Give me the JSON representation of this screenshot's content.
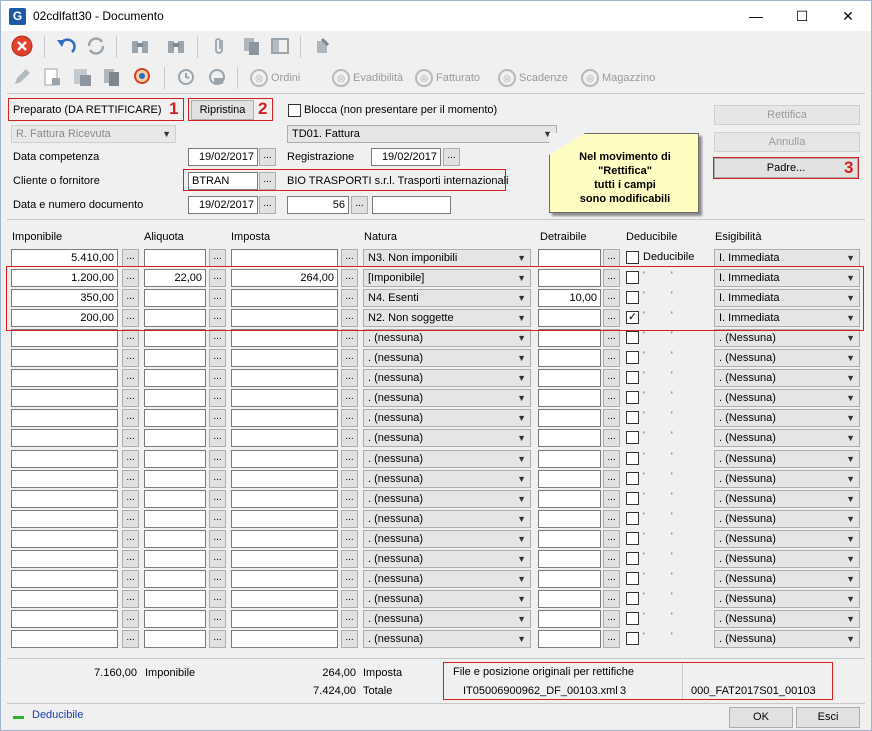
{
  "window": {
    "title": "02cdlfatt30 - Documento",
    "min": "—",
    "max": "☐",
    "close": "✕"
  },
  "toolbar2": {
    "ordini": "Ordini",
    "evadibilita": "Evadibilità",
    "fatturato": "Fatturato",
    "scadenze": "Scadenze",
    "magazzino": "Magazzino"
  },
  "header": {
    "stato": "Preparato (DA RETTIFICARE)",
    "ripristina": "Ripristina",
    "blocca": "Blocca (non presentare per il momento)",
    "tipo_doc": "R. Fattura Ricevuta",
    "td": "TD01. Fattura",
    "data_competenza_label": "Data competenza",
    "data_competenza": "19/02/2017",
    "registrazione_label": "Registrazione",
    "registrazione": "19/02/2017",
    "cliente_label": "Cliente o fornitore",
    "cliente_code": "BTRAN",
    "cliente_name": "BIO TRASPORTI s.r.l. Trasporti internazionali",
    "data_num_label": "Data e numero documento",
    "data_doc": "19/02/2017",
    "num_doc": "56",
    "num_doc_suffix": ""
  },
  "side_buttons": {
    "rettifica": "Rettifica",
    "annulla": "Annulla",
    "padre": "Padre..."
  },
  "note": {
    "line1": "Nel movimento di",
    "line2": "\"Rettifica\"",
    "line3": "tutti i campi",
    "line4": "sono modificabili"
  },
  "markers": {
    "m1": "1",
    "m2": "2",
    "m3": "3"
  },
  "dots": "...",
  "columns": {
    "imponibile": "Imponibile",
    "aliquota": "Aliquota",
    "imposta": "Imposta",
    "natura": "Natura",
    "detraibile": "Detraibile",
    "deducibile": "Deducibile",
    "esigibilita": "Esigibilità"
  },
  "rows": [
    {
      "imponibile": "5.410,00",
      "aliquota": "",
      "imposta": "",
      "natura": "N3. Non imponibili",
      "detraibile": "",
      "deducibile_checked": false,
      "deducibile_label": "Deducibile",
      "esigibilita": "I. Immediata"
    },
    {
      "imponibile": "1.200,00",
      "aliquota": "22,00",
      "imposta": "264,00",
      "natura": "[Imponibile]",
      "detraibile": "",
      "deducibile_checked": false,
      "deducibile_label": "",
      "esigibilita": "I. Immediata"
    },
    {
      "imponibile": "350,00",
      "aliquota": "",
      "imposta": "",
      "natura": "N4. Esenti",
      "detraibile": "10,00",
      "deducibile_checked": false,
      "deducibile_label": "",
      "esigibilita": "I. Immediata"
    },
    {
      "imponibile": "200,00",
      "aliquota": "",
      "imposta": "",
      "natura": "N2. Non soggette",
      "detraibile": "",
      "deducibile_checked": true,
      "deducibile_label": "",
      "esigibilita": "I. Immediata"
    },
    {
      "imponibile": "",
      "aliquota": "",
      "imposta": "",
      "natura": ". (nessuna)",
      "detraibile": "",
      "deducibile_checked": false,
      "deducibile_label": "",
      "esigibilita": ". (Nessuna)"
    },
    {
      "imponibile": "",
      "aliquota": "",
      "imposta": "",
      "natura": ". (nessuna)",
      "detraibile": "",
      "deducibile_checked": false,
      "deducibile_label": "",
      "esigibilita": ". (Nessuna)"
    },
    {
      "imponibile": "",
      "aliquota": "",
      "imposta": "",
      "natura": ". (nessuna)",
      "detraibile": "",
      "deducibile_checked": false,
      "deducibile_label": "",
      "esigibilita": ". (Nessuna)"
    },
    {
      "imponibile": "",
      "aliquota": "",
      "imposta": "",
      "natura": ". (nessuna)",
      "detraibile": "",
      "deducibile_checked": false,
      "deducibile_label": "",
      "esigibilita": ". (Nessuna)"
    },
    {
      "imponibile": "",
      "aliquota": "",
      "imposta": "",
      "natura": ". (nessuna)",
      "detraibile": "",
      "deducibile_checked": false,
      "deducibile_label": "",
      "esigibilita": ". (Nessuna)"
    },
    {
      "imponibile": "",
      "aliquota": "",
      "imposta": "",
      "natura": ". (nessuna)",
      "detraibile": "",
      "deducibile_checked": false,
      "deducibile_label": "",
      "esigibilita": ". (Nessuna)"
    },
    {
      "imponibile": "",
      "aliquota": "",
      "imposta": "",
      "natura": ". (nessuna)",
      "detraibile": "",
      "deducibile_checked": false,
      "deducibile_label": "",
      "esigibilita": ". (Nessuna)"
    },
    {
      "imponibile": "",
      "aliquota": "",
      "imposta": "",
      "natura": ". (nessuna)",
      "detraibile": "",
      "deducibile_checked": false,
      "deducibile_label": "",
      "esigibilita": ". (Nessuna)"
    },
    {
      "imponibile": "",
      "aliquota": "",
      "imposta": "",
      "natura": ". (nessuna)",
      "detraibile": "",
      "deducibile_checked": false,
      "deducibile_label": "",
      "esigibilita": ". (Nessuna)"
    },
    {
      "imponibile": "",
      "aliquota": "",
      "imposta": "",
      "natura": ". (nessuna)",
      "detraibile": "",
      "deducibile_checked": false,
      "deducibile_label": "",
      "esigibilita": ". (Nessuna)"
    },
    {
      "imponibile": "",
      "aliquota": "",
      "imposta": "",
      "natura": ". (nessuna)",
      "detraibile": "",
      "deducibile_checked": false,
      "deducibile_label": "",
      "esigibilita": ". (Nessuna)"
    },
    {
      "imponibile": "",
      "aliquota": "",
      "imposta": "",
      "natura": ". (nessuna)",
      "detraibile": "",
      "deducibile_checked": false,
      "deducibile_label": "",
      "esigibilita": ". (Nessuna)"
    },
    {
      "imponibile": "",
      "aliquota": "",
      "imposta": "",
      "natura": ". (nessuna)",
      "detraibile": "",
      "deducibile_checked": false,
      "deducibile_label": "",
      "esigibilita": ". (Nessuna)"
    },
    {
      "imponibile": "",
      "aliquota": "",
      "imposta": "",
      "natura": ". (nessuna)",
      "detraibile": "",
      "deducibile_checked": false,
      "deducibile_label": "",
      "esigibilita": ". (Nessuna)"
    },
    {
      "imponibile": "",
      "aliquota": "",
      "imposta": "",
      "natura": ". (nessuna)",
      "detraibile": "",
      "deducibile_checked": false,
      "deducibile_label": "",
      "esigibilita": ". (Nessuna)"
    },
    {
      "imponibile": "",
      "aliquota": "",
      "imposta": "",
      "natura": ". (nessuna)",
      "detraibile": "",
      "deducibile_checked": false,
      "deducibile_label": "",
      "esigibilita": ". (Nessuna)"
    }
  ],
  "totals": {
    "imponibile_value": "7.160,00",
    "imponibile_label": "Imponibile",
    "imposta_value": "264,00",
    "imposta_label": "Imposta",
    "totale_value": "7.424,00",
    "totale_label": "Totale"
  },
  "original_file": {
    "label": "File e posizione originali per rettifiche",
    "filename": "IT05006900962_DF_00103.xml",
    "position": "3",
    "code": "000_FAT2017S01_00103"
  },
  "footer": {
    "legend": "Deducibile",
    "ok": "OK",
    "esci": "Esci"
  }
}
